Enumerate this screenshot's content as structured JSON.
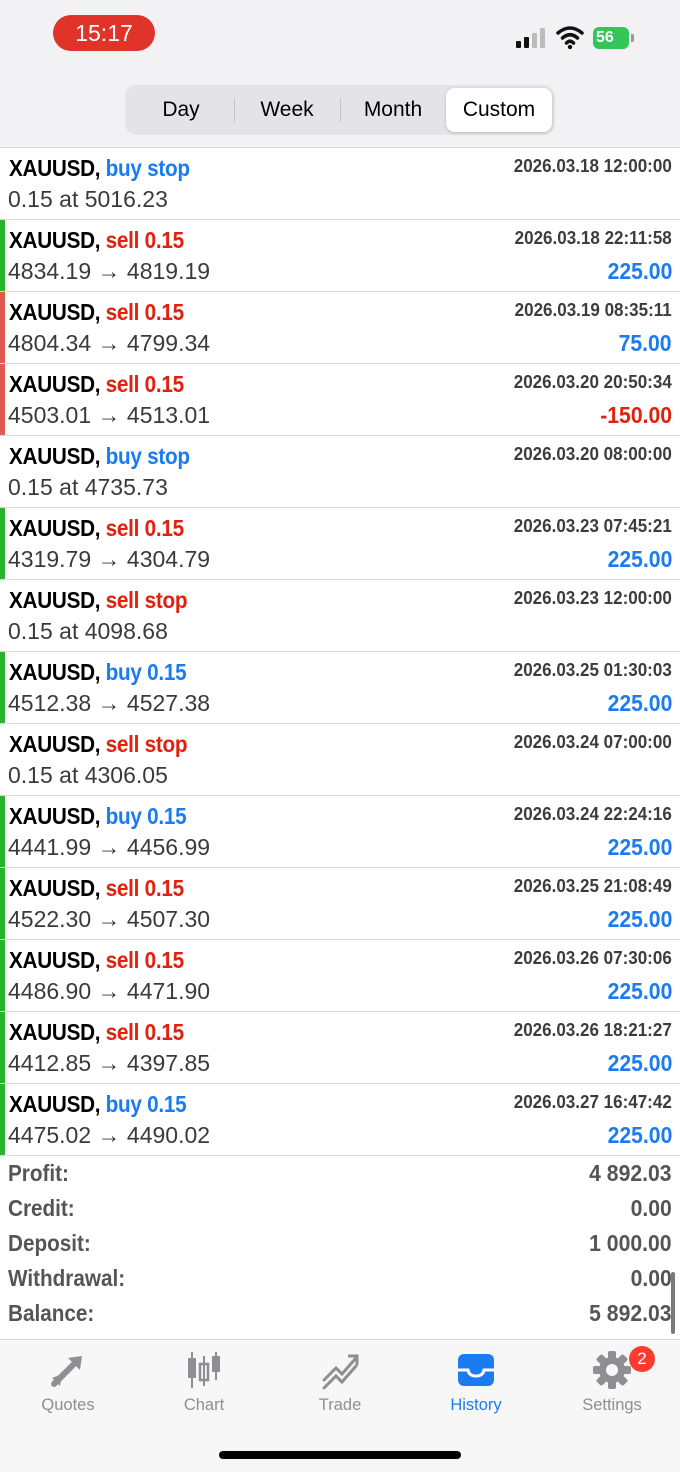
{
  "status": {
    "time": "15:17",
    "battery": "56"
  },
  "period_tabs": [
    "Day",
    "Week",
    "Month",
    "Custom"
  ],
  "active_period": "Custom",
  "colors": {
    "buy": "#1a7cf0",
    "sell": "#e0210f",
    "profit": "#1a7cf0",
    "loss": "#e0210f",
    "win_bar": "#29b42c",
    "loss_bar": "#e05a4f"
  },
  "trades": [
    {
      "symbol": "XAUUSD,",
      "side": "buy stop",
      "side_kind": "buy",
      "date": "2026.03.18 12:00:00",
      "detail": "0.15 at 5016.23",
      "profit": "",
      "result": "none"
    },
    {
      "symbol": "XAUUSD,",
      "side": "sell 0.15",
      "side_kind": "sell",
      "date": "2026.03.18 22:11:58",
      "detail": "4834.19 → 4819.19",
      "profit": "225.00",
      "result": "win"
    },
    {
      "symbol": "XAUUSD,",
      "side": "sell 0.15",
      "side_kind": "sell",
      "date": "2026.03.19 08:35:11",
      "detail": "4804.34 → 4799.34",
      "profit": "75.00",
      "result": "loss"
    },
    {
      "symbol": "XAUUSD,",
      "side": "sell 0.15",
      "side_kind": "sell",
      "date": "2026.03.20 20:50:34",
      "detail": "4503.01 → 4513.01",
      "profit": "-150.00",
      "result": "loss"
    },
    {
      "symbol": "XAUUSD,",
      "side": "buy stop",
      "side_kind": "buy",
      "date": "2026.03.20 08:00:00",
      "detail": "0.15 at 4735.73",
      "profit": "",
      "result": "none"
    },
    {
      "symbol": "XAUUSD,",
      "side": "sell 0.15",
      "side_kind": "sell",
      "date": "2026.03.23 07:45:21",
      "detail": "4319.79 → 4304.79",
      "profit": "225.00",
      "result": "win"
    },
    {
      "symbol": "XAUUSD,",
      "side": "sell stop",
      "side_kind": "sell",
      "date": "2026.03.23 12:00:00",
      "detail": "0.15 at 4098.68",
      "profit": "",
      "result": "none"
    },
    {
      "symbol": "XAUUSD,",
      "side": "buy 0.15",
      "side_kind": "buy",
      "date": "2026.03.25 01:30:03",
      "detail": "4512.38 → 4527.38",
      "profit": "225.00",
      "result": "win"
    },
    {
      "symbol": "XAUUSD,",
      "side": "sell stop",
      "side_kind": "sell",
      "date": "2026.03.24 07:00:00",
      "detail": "0.15 at 4306.05",
      "profit": "",
      "result": "none"
    },
    {
      "symbol": "XAUUSD,",
      "side": "buy 0.15",
      "side_kind": "buy",
      "date": "2026.03.24 22:24:16",
      "detail": "4441.99 → 4456.99",
      "profit": "225.00",
      "result": "win"
    },
    {
      "symbol": "XAUUSD,",
      "side": "sell 0.15",
      "side_kind": "sell",
      "date": "2026.03.25 21:08:49",
      "detail": "4522.30 → 4507.30",
      "profit": "225.00",
      "result": "win"
    },
    {
      "symbol": "XAUUSD,",
      "side": "sell 0.15",
      "side_kind": "sell",
      "date": "2026.03.26 07:30:06",
      "detail": "4486.90 → 4471.90",
      "profit": "225.00",
      "result": "win"
    },
    {
      "symbol": "XAUUSD,",
      "side": "sell 0.15",
      "side_kind": "sell",
      "date": "2026.03.26 18:21:27",
      "detail": "4412.85 → 4397.85",
      "profit": "225.00",
      "result": "win"
    },
    {
      "symbol": "XAUUSD,",
      "side": "buy 0.15",
      "side_kind": "buy",
      "date": "2026.03.27 16:47:42",
      "detail": "4475.02 → 4490.02",
      "profit": "225.00",
      "result": "win"
    }
  ],
  "summary": [
    {
      "label": "Profit:",
      "value": "4 892.03"
    },
    {
      "label": "Credit:",
      "value": "0.00"
    },
    {
      "label": "Deposit:",
      "value": "1 000.00"
    },
    {
      "label": "Withdrawal:",
      "value": "0.00"
    },
    {
      "label": "Balance:",
      "value": "5 892.03"
    }
  ],
  "tabbar": [
    {
      "label": "Quotes",
      "icon": "quotes-icon"
    },
    {
      "label": "Chart",
      "icon": "chart-icon"
    },
    {
      "label": "Trade",
      "icon": "trade-icon"
    },
    {
      "label": "History",
      "icon": "history-icon",
      "active": true
    },
    {
      "label": "Settings",
      "icon": "gear-icon",
      "badge": "2"
    }
  ]
}
